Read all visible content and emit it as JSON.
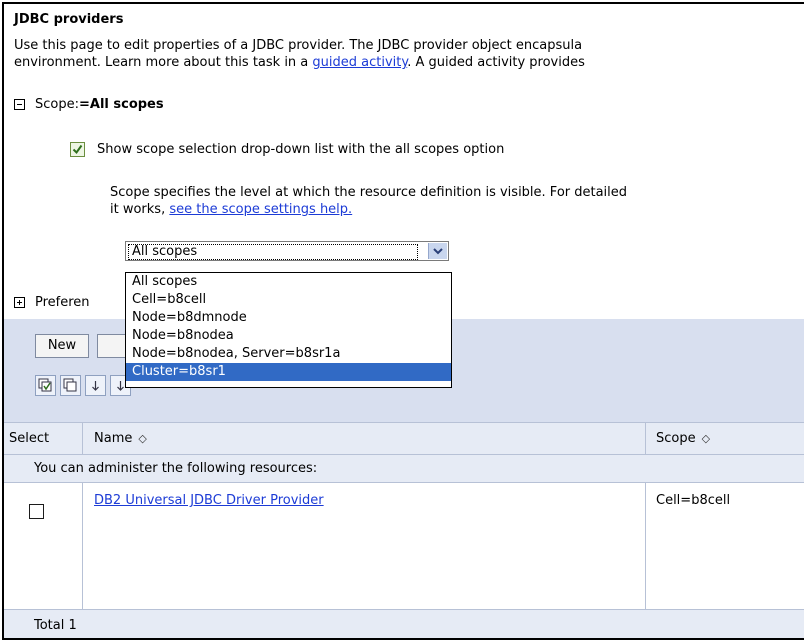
{
  "page": {
    "title": "JDBC providers",
    "description": {
      "line1": "Use this page to edit properties of a JDBC provider. The JDBC provider object encapsula",
      "line2_before": "environment. Learn more about this task in a ",
      "line2_link": "guided activity",
      "line2_after": ". A guided activity provides"
    }
  },
  "scope": {
    "label": "Scope: ",
    "value": "=All scopes",
    "show_dropdown_label": "Show scope selection drop-down list with the all scopes option",
    "help_line1": "Scope specifies the level at which the resource definition is visible. For detailed",
    "help_line2_before": "it works, ",
    "help_line2_link": "see the scope settings help.",
    "selected": "All scopes",
    "options": [
      "All scopes",
      "Cell=b8cell",
      "Node=b8dmnode",
      "Node=b8nodea",
      "Node=b8nodea, Server=b8sr1a",
      "Cluster=b8sr1"
    ],
    "highlighted_index": 5
  },
  "preferences": {
    "label": "Preferen"
  },
  "toolbar": {
    "new_label": "New",
    "icons": [
      "select-all-icon",
      "deselect-all-icon",
      "export-icon",
      "import-icon"
    ]
  },
  "table": {
    "headers": {
      "select": "Select",
      "name": "Name",
      "scope": "Scope"
    },
    "sort_glyph": "◇",
    "admin_note": "You can administer the following resources:",
    "rows": [
      {
        "name": "DB2 Universal JDBC Driver Provider",
        "scope": "Cell=b8cell"
      }
    ],
    "total": "Total 1"
  },
  "colors": {
    "link": "#1c3bd6",
    "band": "#d8dfef",
    "header": "#e6ebf5",
    "highlight": "#316ac5"
  }
}
